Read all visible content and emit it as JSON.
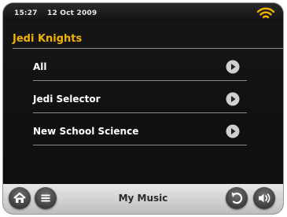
{
  "status_bar": {
    "time": "15:27",
    "date": "12 Oct  2009",
    "wifi_icon": "wifi-signal-icon",
    "wifi_color": "#f2b300"
  },
  "page": {
    "title": "Jedi Knights",
    "title_color": "#f2b300"
  },
  "list": {
    "items": [
      {
        "label": "All",
        "icon": "play-arrow-icon"
      },
      {
        "label": "Jedi Selector",
        "icon": "play-arrow-icon"
      },
      {
        "label": "New School Science",
        "icon": "play-arrow-icon"
      }
    ]
  },
  "toolbar": {
    "home_icon": "home-icon",
    "menu_icon": "menu-icon",
    "center_label": "My Music",
    "back_icon": "back-icon",
    "volume_icon": "volume-icon"
  }
}
